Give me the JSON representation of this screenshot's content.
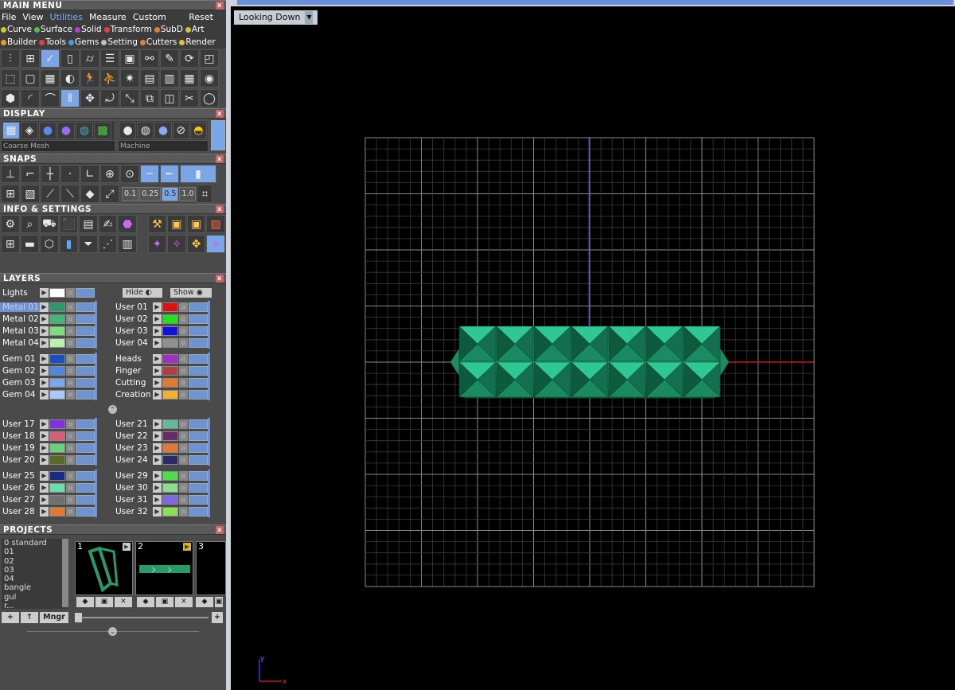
{
  "main_menu": {
    "title": "MAIN MENU",
    "items": [
      "File",
      "View",
      "Utilities",
      "Measure",
      "Custom"
    ],
    "reset": "Reset",
    "tabs_row1": [
      {
        "label": "Curve",
        "color": "#c9c940"
      },
      {
        "label": "Surface",
        "color": "#4cc24c"
      },
      {
        "label": "Solid",
        "color": "#b040d0"
      },
      {
        "label": "Transform",
        "color": "#e04040"
      },
      {
        "label": "SubD",
        "color": "#e08030"
      },
      {
        "label": "Art",
        "color": "#c9c940"
      }
    ],
    "tabs_row2": [
      {
        "label": "Builder",
        "color": "#e0a030"
      },
      {
        "label": "Tools",
        "color": "#e04040"
      },
      {
        "label": "Gems",
        "color": "#40a0e0"
      },
      {
        "label": "Setting",
        "color": "#c0c0c0"
      },
      {
        "label": "Cutters",
        "color": "#e08030"
      },
      {
        "label": "Render",
        "color": "#e0c040"
      }
    ]
  },
  "display": {
    "title": "DISPLAY",
    "mesh_mode": "Coarse Mesh",
    "material": "Machine"
  },
  "snaps": {
    "title": "SNAPS",
    "values": [
      "0.1",
      "0.25",
      "0.5",
      "1.0"
    ]
  },
  "info": {
    "title": "INFO & SETTINGS"
  },
  "layers": {
    "title": "LAYERS",
    "lights": "Lights",
    "hide": "Hide",
    "show": "Show",
    "left_groups": [
      [
        {
          "name": "Metal 01",
          "color": "#2e9a6c"
        },
        {
          "name": "Metal 02",
          "color": "#3fb878"
        },
        {
          "name": "Metal 03",
          "color": "#7adf7a"
        },
        {
          "name": "Metal 04",
          "color": "#b8f0b0"
        }
      ],
      [
        {
          "name": "Gem 01",
          "color": "#1a4fc0"
        },
        {
          "name": "Gem 02",
          "color": "#4f86e0"
        },
        {
          "name": "Gem 03",
          "color": "#7aa8f0"
        },
        {
          "name": "Gem 04",
          "color": "#a8c8f8"
        }
      ],
      [
        {
          "name": "User 17",
          "color": "#8030e0"
        },
        {
          "name": "User 18",
          "color": "#e05a7a"
        },
        {
          "name": "User 19",
          "color": "#6ad07a"
        },
        {
          "name": "User 20",
          "color": "#5a6a20"
        }
      ],
      [
        {
          "name": "User 25",
          "color": "#1a2a8a"
        },
        {
          "name": "User 26",
          "color": "#6ae0a8"
        },
        {
          "name": "User 27",
          "color": "#707070"
        },
        {
          "name": "User 28",
          "color": "#e07a30"
        }
      ]
    ],
    "right_groups": [
      [
        {
          "name": "User 01",
          "color": "#e01010"
        },
        {
          "name": "User 02",
          "color": "#20e020"
        },
        {
          "name": "User 03",
          "color": "#1010e0"
        },
        {
          "name": "User 04",
          "color": "#909090"
        }
      ],
      [
        {
          "name": "Heads",
          "color": "#a030c0"
        },
        {
          "name": "Finger",
          "color": "#b04040"
        },
        {
          "name": "Cutting",
          "color": "#e07a30"
        },
        {
          "name": "Creation",
          "color": "#f0b030"
        }
      ],
      [
        {
          "name": "User 21",
          "color": "#6ab89a"
        },
        {
          "name": "User 22",
          "color": "#6a2a6a"
        },
        {
          "name": "User 23",
          "color": "#e07a30"
        },
        {
          "name": "User 24",
          "color": "#2a2a6a"
        }
      ],
      [
        {
          "name": "User 29",
          "color": "#4ae04a"
        },
        {
          "name": "User 30",
          "color": "#8ae08a"
        },
        {
          "name": "User 31",
          "color": "#7a6ae0"
        },
        {
          "name": "User 32",
          "color": "#8ae050"
        }
      ]
    ]
  },
  "projects": {
    "title": "PROJECTS",
    "list": [
      "0 standard",
      "01",
      "02",
      "03",
      "04",
      "bangle",
      "gul",
      "r..."
    ],
    "thumbs": [
      "1",
      "2",
      "3"
    ],
    "mngr": "Mngr"
  },
  "viewport": {
    "view_name": "Looking Down",
    "axis_y": "y",
    "axis_x": "x"
  }
}
